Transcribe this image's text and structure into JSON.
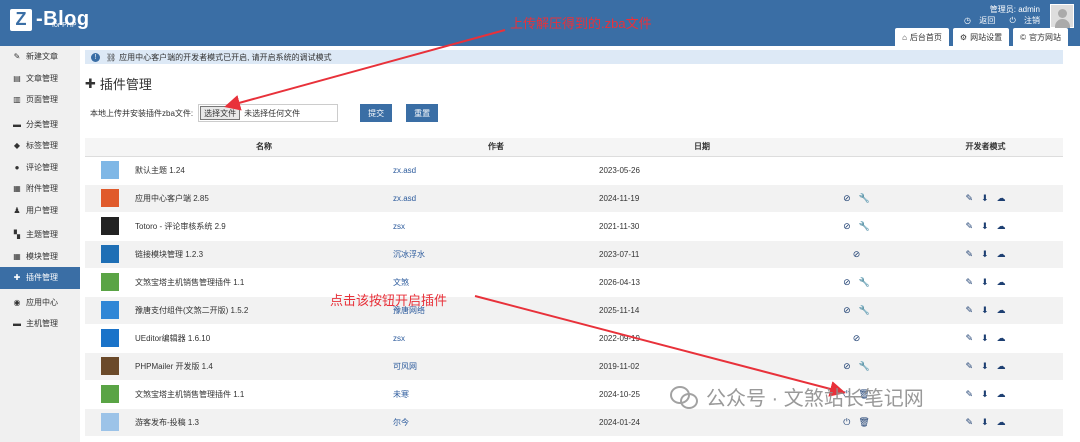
{
  "header": {
    "logo_letter": "Z",
    "logo_text": "-Blog",
    "logo_sub": "for PHP",
    "user_label": "管理员: admin",
    "link_back": "返回",
    "link_logout": "注销",
    "tabs": [
      {
        "label": "后台首页",
        "icon": "home-icon"
      },
      {
        "label": "网站设置",
        "icon": "gear-icon"
      },
      {
        "label": "官方网站",
        "icon": "copyright-icon"
      }
    ]
  },
  "annotations": {
    "top": "上传解压得到的.zba文件",
    "middle": "点击该按钮开启插件",
    "color": "#e8313a"
  },
  "sidebar": {
    "items": [
      {
        "label": "新建文章",
        "icon": "edit-icon",
        "glyph": "✎"
      },
      {
        "label": "文章管理",
        "icon": "article-icon",
        "glyph": "▤"
      },
      {
        "label": "页面管理",
        "icon": "page-icon",
        "glyph": "▥"
      },
      {
        "label": "分类管理",
        "icon": "folder-icon",
        "glyph": "▬"
      },
      {
        "label": "标签管理",
        "icon": "tag-icon",
        "glyph": "◆"
      },
      {
        "label": "评论管理",
        "icon": "comment-icon",
        "glyph": "●"
      },
      {
        "label": "附件管理",
        "icon": "attachment-icon",
        "glyph": "▦"
      },
      {
        "label": "用户管理",
        "icon": "users-icon",
        "glyph": "♟"
      },
      {
        "label": "主题管理",
        "icon": "theme-icon",
        "glyph": "▚"
      },
      {
        "label": "模块管理",
        "icon": "module-icon",
        "glyph": "▦"
      },
      {
        "label": "插件管理",
        "icon": "puzzle-icon",
        "glyph": "✚"
      },
      {
        "label": "应用中心",
        "icon": "app-center-icon",
        "glyph": "◉"
      },
      {
        "label": "主机管理",
        "icon": "server-icon",
        "glyph": "▬"
      }
    ],
    "active_index": 10
  },
  "notice": {
    "text": "应用中心客户端的开发者模式已开启, 请开启系统的调试模式"
  },
  "page": {
    "title": "插件管理",
    "upload_label": "本地上传并安装插件zba文件:",
    "file_button": "选择文件",
    "file_status": "未选择任何文件",
    "submit": "提交",
    "reset": "重置"
  },
  "table": {
    "headers": [
      "名称",
      "作者",
      "日期",
      "开发者模式"
    ],
    "rows": [
      {
        "name": "默认主题 1.24",
        "author": "zx.asd",
        "date": "2023-05-26",
        "actions": [],
        "dev": false,
        "icon_color": "#7fb7e6"
      },
      {
        "name": "应用中心客户端 2.85",
        "author": "zx.asd",
        "date": "2024-11-19",
        "actions": [
          "ban",
          "wrench"
        ],
        "dev": true,
        "icon_color": "#e05a2b"
      },
      {
        "name": "Totoro - 评论审核系统 2.9",
        "author": "zsx",
        "date": "2021-11-30",
        "actions": [
          "ban",
          "wrench"
        ],
        "dev": true,
        "icon_color": "#222222"
      },
      {
        "name": "链接模块管理 1.2.3",
        "author": "沉冰浮水",
        "date": "2023-07-11",
        "actions": [
          "ban"
        ],
        "dev": true,
        "icon_color": "#1f6fb5"
      },
      {
        "name": "文煞宝塔主机销售管理插件 1.1",
        "author": "文煞",
        "date": "2026-04-13",
        "actions": [
          "ban",
          "wrench"
        ],
        "dev": true,
        "icon_color": "#5aa445"
      },
      {
        "name": "豫唐支付组件(文煞二开版) 1.5.2",
        "author": "豫唐网络",
        "date": "2025-11-14",
        "actions": [
          "ban",
          "wrench"
        ],
        "dev": true,
        "icon_color": "#2f86d6"
      },
      {
        "name": "UEditor编辑器 1.6.10",
        "author": "zsx",
        "date": "2022-09-19",
        "actions": [
          "ban"
        ],
        "dev": true,
        "icon_color": "#1a73c9"
      },
      {
        "name": "PHPMailer 开发版 1.4",
        "author": "可风网",
        "date": "2019-11-02",
        "actions": [
          "ban",
          "wrench"
        ],
        "dev": true,
        "icon_color": "#6b4a2a"
      },
      {
        "name": "文煞宝塔主机销售管理插件 1.1",
        "author": "未寒",
        "date": "2024-10-25",
        "actions": [
          "power",
          "trash"
        ],
        "dev": true,
        "icon_color": "#5aa445"
      },
      {
        "name": "游客发布-投稿 1.3",
        "author": "尔今",
        "date": "2024-01-24",
        "actions": [
          "power",
          "trash"
        ],
        "dev": true,
        "icon_color": "#9cc3e8"
      }
    ]
  },
  "watermark": {
    "text": "公众号 · 文煞站长笔记网"
  }
}
